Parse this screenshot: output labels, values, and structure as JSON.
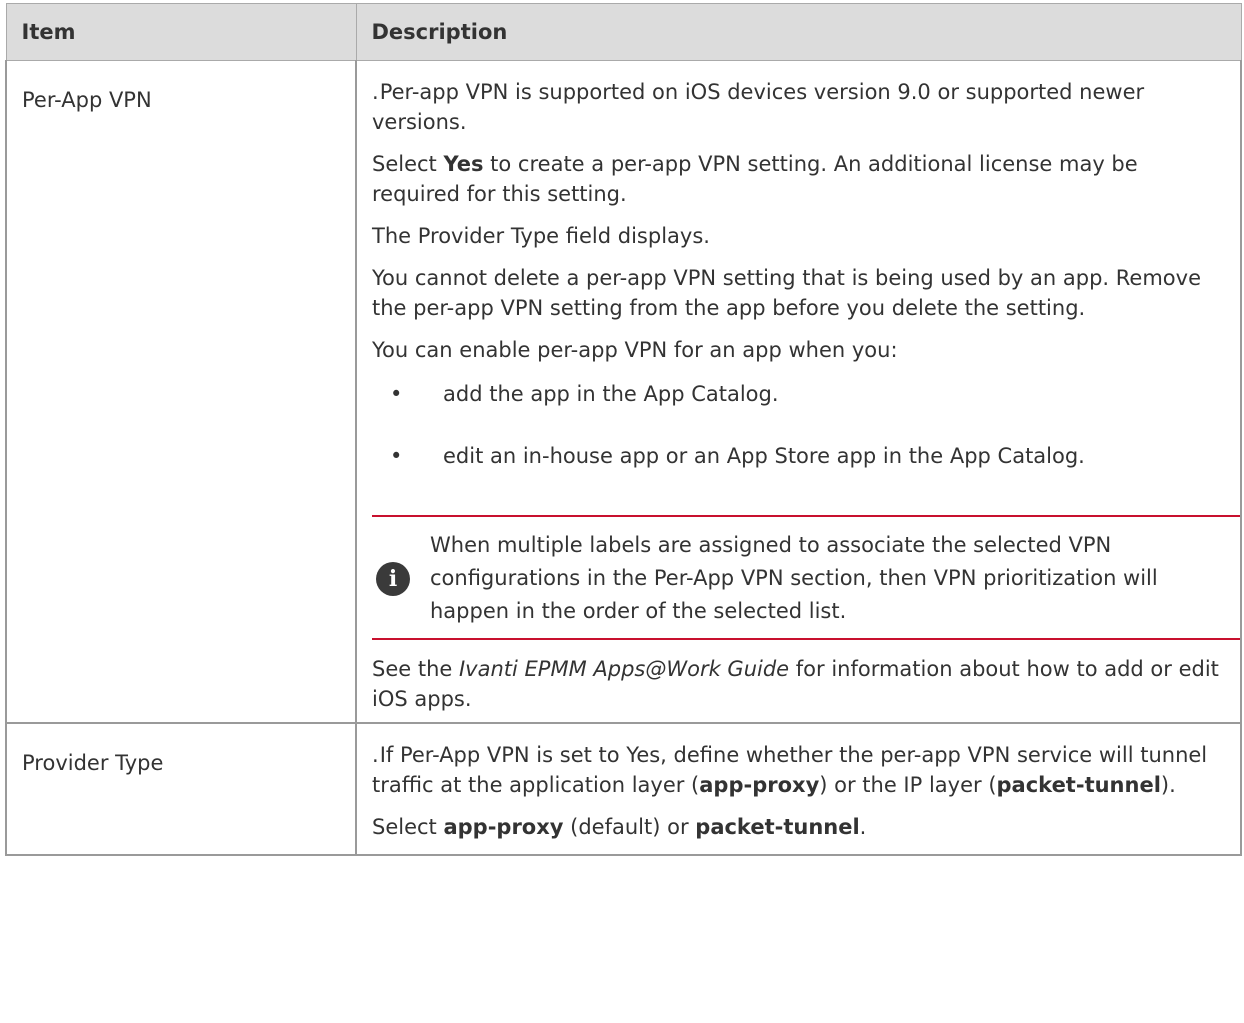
{
  "table": {
    "header": {
      "item": "Item",
      "description": "Description"
    },
    "rows": [
      {
        "item": "Per-App VPN",
        "p1_dot": ".",
        "p1": "Per-app VPN is supported on iOS devices version 9.0 or supported newer versions.",
        "p2_select": "Select ",
        "p2_yes": "Yes",
        "p2_rest": " to create a per-app VPN setting. An additional license may be required for this setting.",
        "p3": "The Provider Type field displays.",
        "p4": "You cannot delete a per-app VPN setting that is being used by an app. Remove the per-app VPN setting from the app before you delete the setting.",
        "p5": "You can enable per-app VPN for an app when you:",
        "bullets": [
          "add the app in the App Catalog.",
          "edit an in-house app or an App Store app in the App Catalog."
        ],
        "bullet_symbol": "•",
        "note_icon": "i",
        "note": "When multiple labels are assigned to associate the selected VPN configurations in the Per-App VPN section, then VPN prioritization will happen in the order of the selected list.",
        "p6_see": "See the ",
        "p6_guide": "Ivanti EPMM Apps@Work Guide",
        "p6_rest": " for information about how to add or edit iOS apps."
      },
      {
        "item": "Provider Type",
        "p1_dot": ".",
        "p1_a": "If Per-App VPN is set to Yes, define whether the per-app VPN service will tunnel traffic at the application layer (",
        "p1_b": "app-proxy",
        "p1_c": ") or the IP layer (",
        "p1_d": "packet-tunnel",
        "p1_e": ").",
        "p2_a": "Select ",
        "p2_b": "app-proxy",
        "p2_c": " (default) or ",
        "p2_d": "packet-tunnel",
        "p2_e": "."
      }
    ]
  },
  "colors": {
    "header_bg": "#dcdcdc",
    "note_rule": "#c8102e",
    "text": "#333333"
  }
}
